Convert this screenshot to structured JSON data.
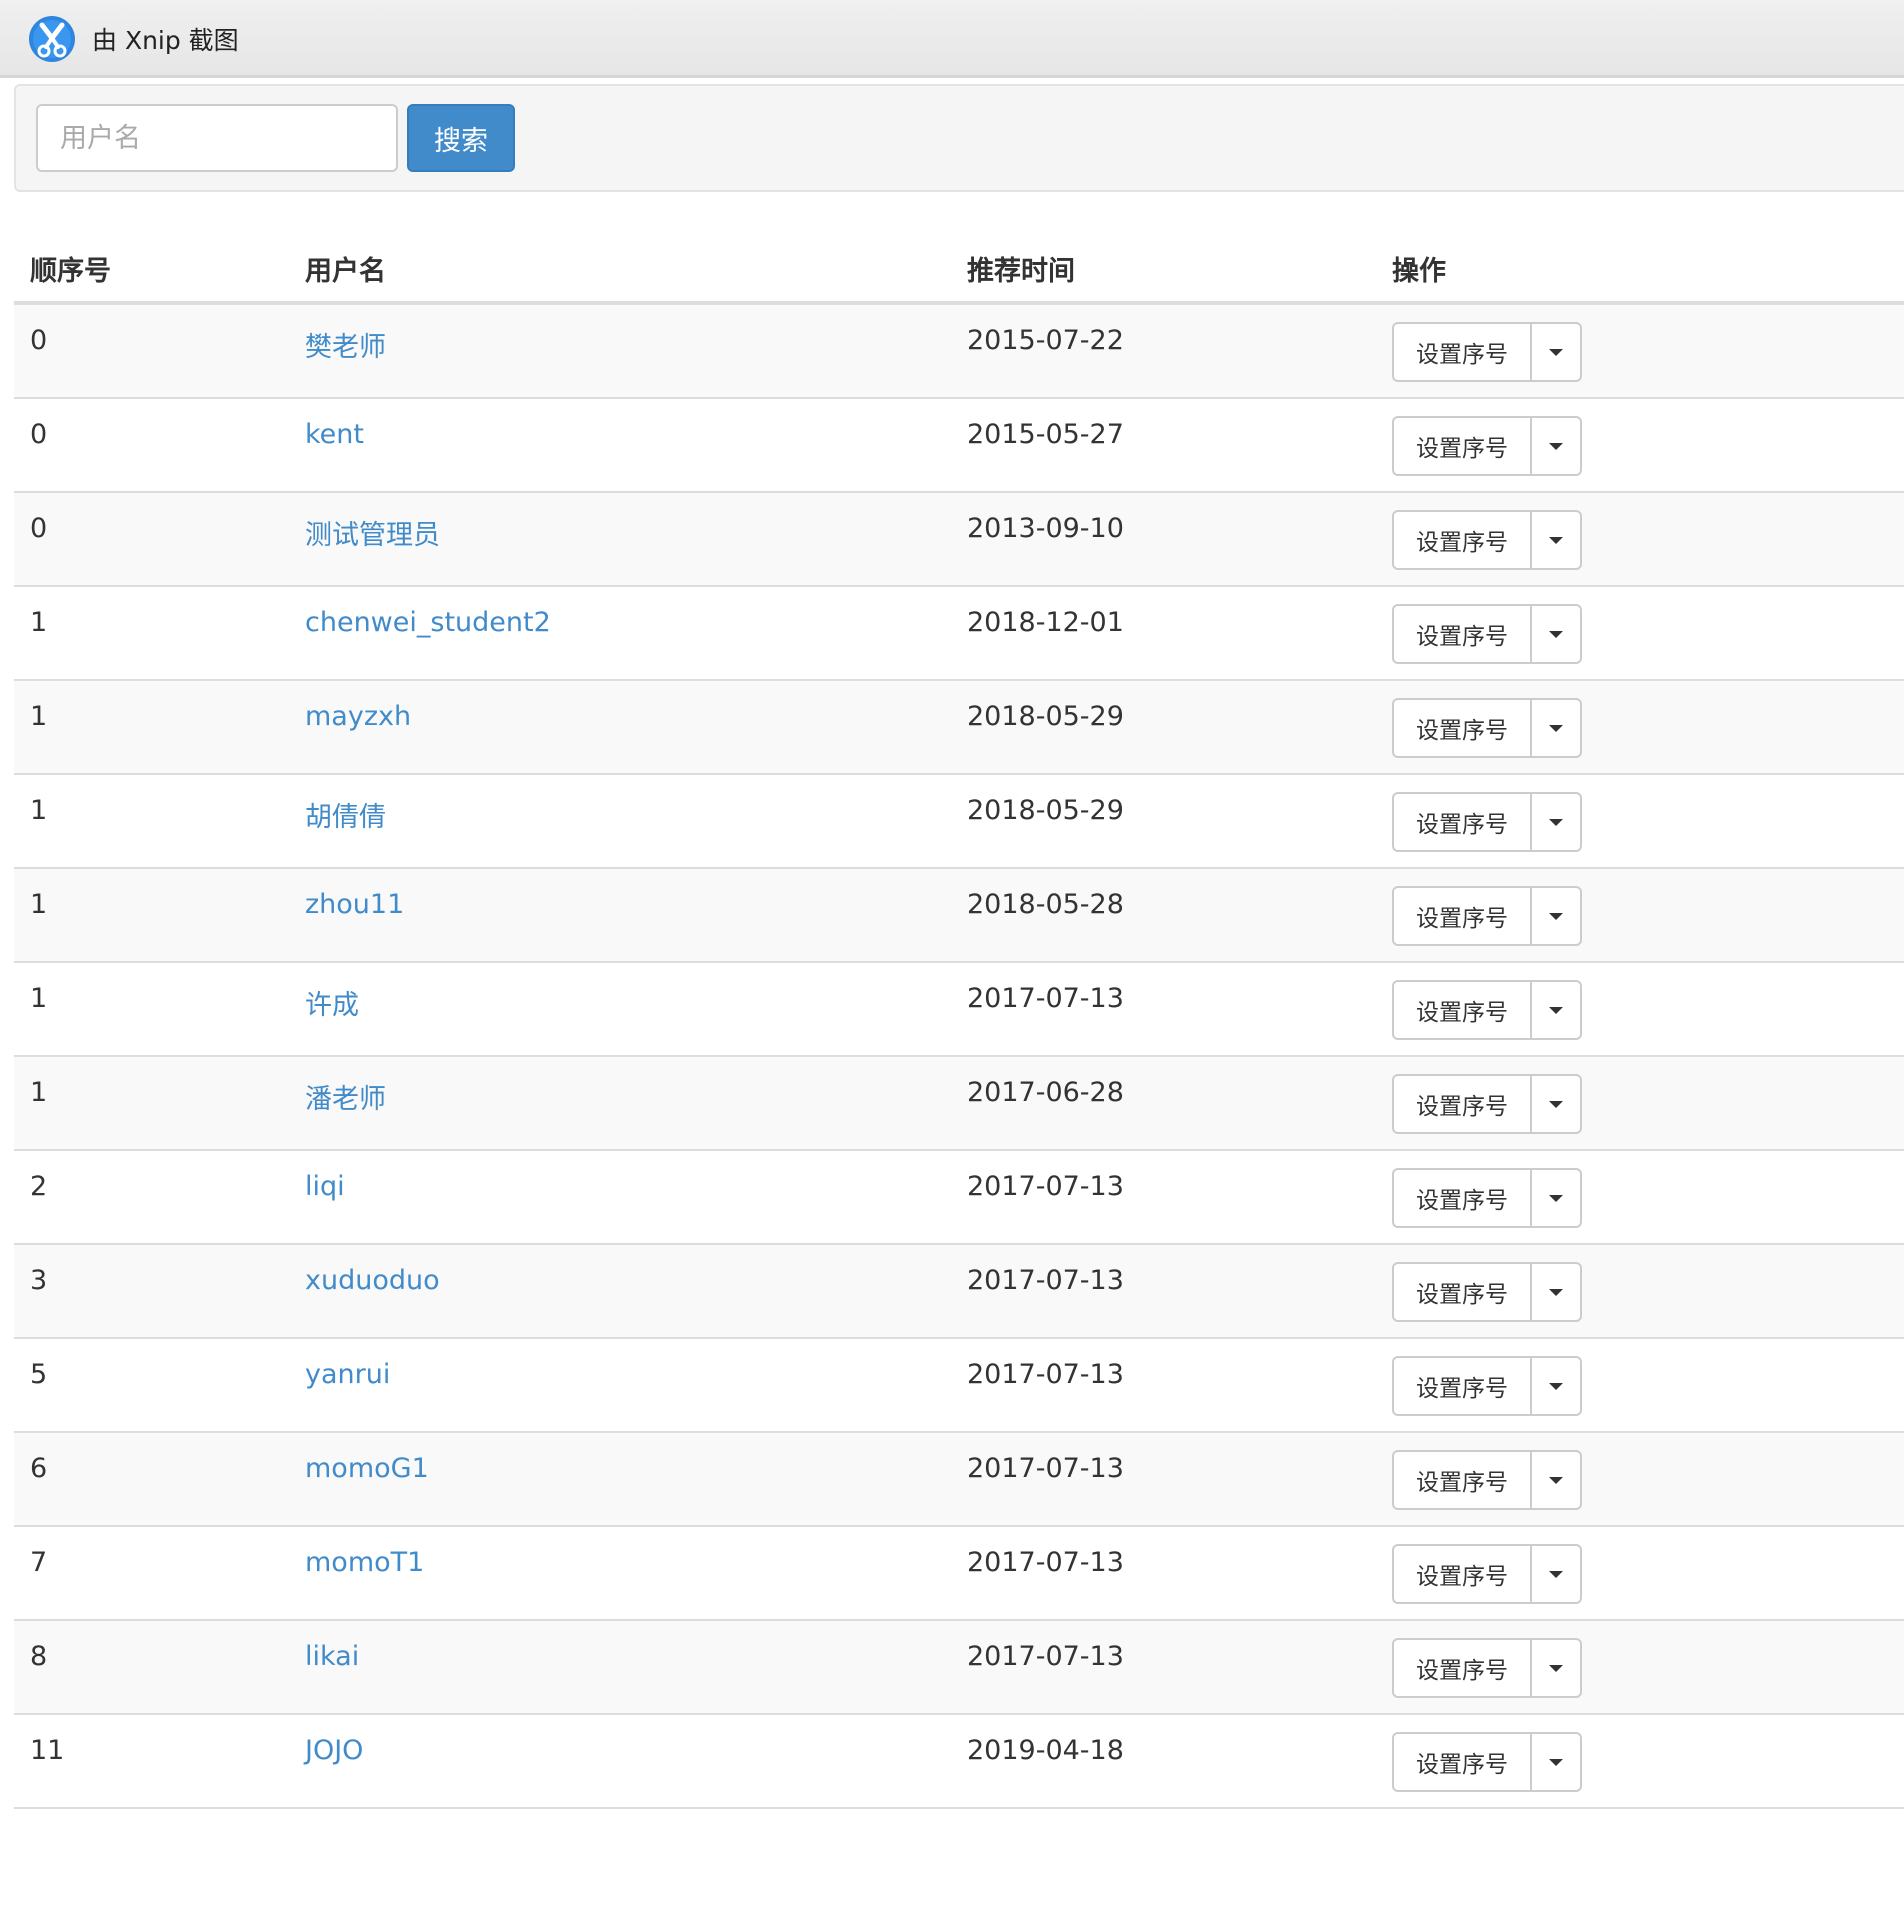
{
  "window": {
    "title": "由 Xnip 截图",
    "logo_icon": "xnip-scissors-icon"
  },
  "search": {
    "placeholder": "用户名",
    "value": "",
    "button_label": "搜索",
    "button_color": "#428bca"
  },
  "table": {
    "headers": {
      "seq": "顺序号",
      "username": "用户名",
      "time": "推荐时间",
      "action": "操作"
    },
    "action_label": "设置序号",
    "action_caret_icon": "caret-down-icon",
    "link_color": "#428bca",
    "rows": [
      {
        "seq": "0",
        "username": "樊老师",
        "time": "2015-07-22"
      },
      {
        "seq": "0",
        "username": "kent",
        "time": "2015-05-27"
      },
      {
        "seq": "0",
        "username": "测试管理员",
        "time": "2013-09-10"
      },
      {
        "seq": "1",
        "username": "chenwei_student2",
        "time": "2018-12-01"
      },
      {
        "seq": "1",
        "username": "mayzxh",
        "time": "2018-05-29"
      },
      {
        "seq": "1",
        "username": "胡倩倩",
        "time": "2018-05-29"
      },
      {
        "seq": "1",
        "username": "zhou11",
        "time": "2018-05-28"
      },
      {
        "seq": "1",
        "username": "许成",
        "time": "2017-07-13"
      },
      {
        "seq": "1",
        "username": "潘老师",
        "time": "2017-06-28"
      },
      {
        "seq": "2",
        "username": "liqi",
        "time": "2017-07-13"
      },
      {
        "seq": "3",
        "username": "xuduoduo",
        "time": "2017-07-13"
      },
      {
        "seq": "5",
        "username": "yanrui",
        "time": "2017-07-13"
      },
      {
        "seq": "6",
        "username": "momoG1",
        "time": "2017-07-13"
      },
      {
        "seq": "7",
        "username": "momoT1",
        "time": "2017-07-13"
      },
      {
        "seq": "8",
        "username": "likai",
        "time": "2017-07-13"
      },
      {
        "seq": "11",
        "username": "JOJO",
        "time": "2019-04-18"
      }
    ]
  }
}
